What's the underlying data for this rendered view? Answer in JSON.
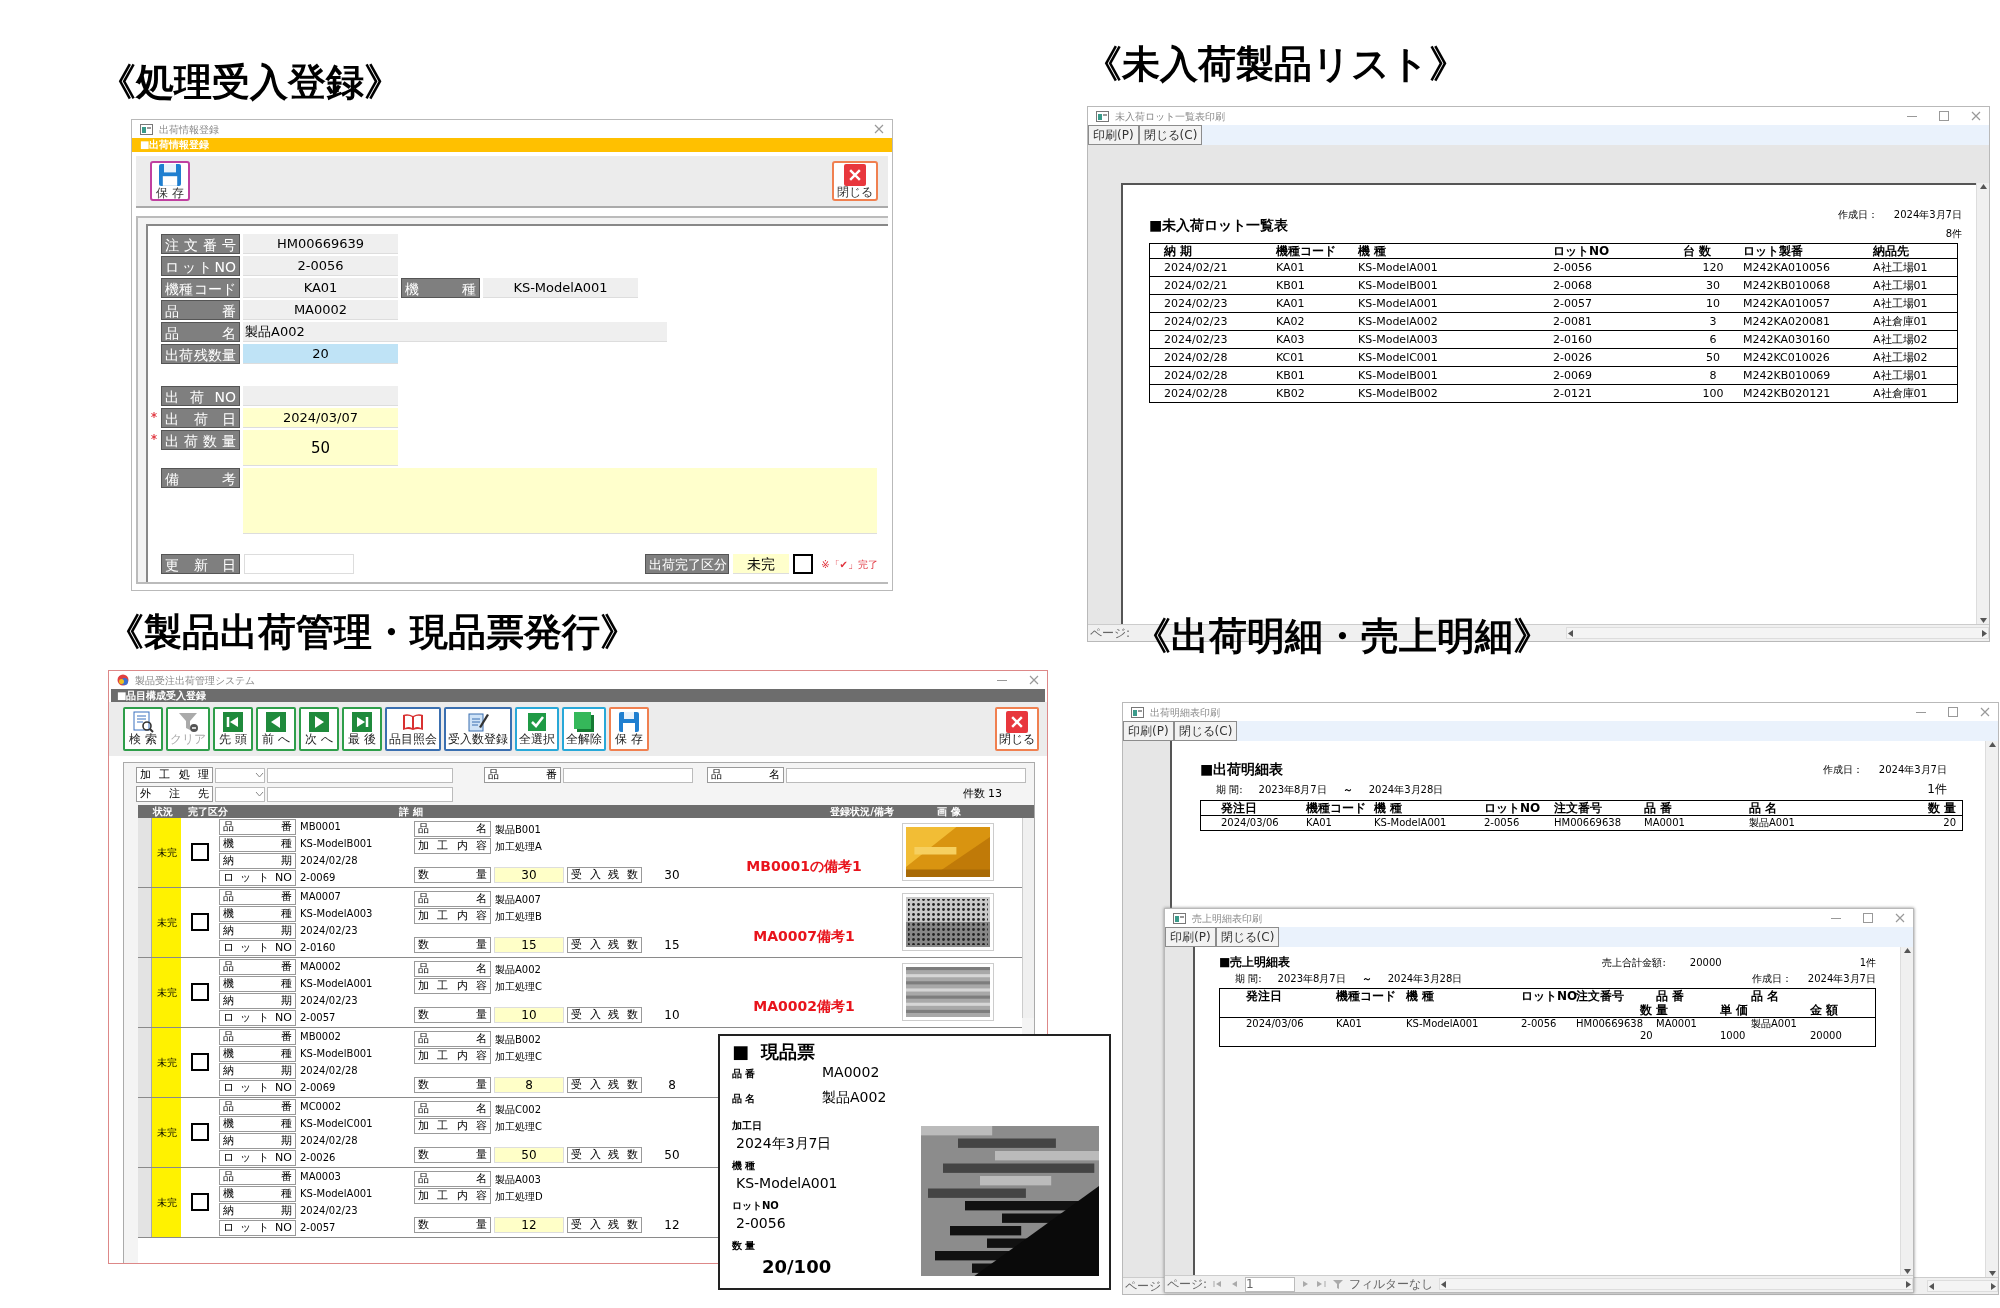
{
  "entry_form": {
    "heading": "《処理受入登録》",
    "window_title": "出荷情報登録",
    "banner": "■出荷情報登録",
    "save_button": "保 存",
    "close_button": "閉じる",
    "product_rows": [
      [
        {
          "label": "注文番号",
          "value": "HM00669639",
          "color": "#efefef",
          "kind": "short"
        }
      ],
      [
        {
          "label": "ロットNO",
          "value": "2-0056",
          "color": "#efefef",
          "kind": "short"
        }
      ],
      [
        {
          "label": "機種コード",
          "value": "KA01",
          "color": "#efefef",
          "kind": "short"
        },
        {
          "label": "機種",
          "value": "KS-ModelA001",
          "color": "#efefef",
          "kind": "short"
        }
      ],
      [
        {
          "label": "品番",
          "value": "MA0002",
          "color": "#efefef",
          "kind": "short"
        }
      ],
      [
        {
          "label": "品名",
          "value": "製品A002",
          "color": "#efefef",
          "kind": "wide"
        }
      ],
      [
        {
          "label": "出荷残数量",
          "value": "20",
          "color": "#bfe3f6",
          "kind": "short"
        }
      ]
    ],
    "shipment_fields": [
      {
        "label": "出荷NO",
        "color": "#efefef",
        "kind": "short",
        "required": false
      },
      {
        "label": "出荷日",
        "value": "2024/03/07",
        "color": "#ffffcc",
        "kind": "short",
        "required": true
      },
      {
        "label": "出荷数量",
        "value": "50",
        "color": "#ffffcc",
        "kind": "tall",
        "required": true
      },
      {
        "label": "備考",
        "color": "#ffffcc",
        "kind": "memo",
        "required": false
      }
    ],
    "update_label": "更新日",
    "completion": {
      "label": "出荷完了区分",
      "value": "未完",
      "checked": false,
      "note": "※「✔」完了"
    }
  },
  "unreceived_list": {
    "heading": "《未入荷製品リスト》",
    "window_title": "未入荷ロット一覧表印刷",
    "toolbar": [
      "印刷(P)",
      "閉じる(C)"
    ],
    "report_title": "■未入荷ロット一覧表",
    "created_label": "作成日：",
    "created_date": "2024年3月7日",
    "count": "8件",
    "columns": [
      "納 期",
      "機種コード",
      "機 種",
      "ロットNO",
      "台 数",
      "ロット製番",
      "納品先"
    ],
    "rows": [
      [
        "2024/02/21",
        "KA01",
        "KS-ModelA001",
        "2-0056",
        "120",
        "M242KA010056",
        "A社工場01"
      ],
      [
        "2024/02/21",
        "KB01",
        "KS-ModelB001",
        "2-0068",
        "30",
        "M242KB010068",
        "A社工場01"
      ],
      [
        "2024/02/23",
        "KA01",
        "KS-ModelA001",
        "2-0057",
        "10",
        "M242KA010057",
        "A社工場01"
      ],
      [
        "2024/02/23",
        "KA02",
        "KS-ModelA002",
        "2-0081",
        "3",
        "M242KA020081",
        "A社倉庫01"
      ],
      [
        "2024/02/23",
        "KA03",
        "KS-ModelA003",
        "2-0160",
        "6",
        "M242KA030160",
        "A社工場02"
      ],
      [
        "2024/02/28",
        "KC01",
        "KS-ModelC001",
        "2-0026",
        "50",
        "M242KC010026",
        "A社工場02"
      ],
      [
        "2024/02/28",
        "KB01",
        "KS-ModelB001",
        "2-0069",
        "8",
        "M242KB010069",
        "A社工場01"
      ],
      [
        "2024/02/28",
        "KB02",
        "KS-ModelB002",
        "2-0121",
        "100",
        "M242KB020121",
        "A社倉庫01"
      ]
    ],
    "status": "ページ:"
  },
  "shipping_system": {
    "heading": "《製品出荷管理・現品票発行》",
    "window_title": "製品受注出荷管理システム",
    "banner": "■品目構成受入登録",
    "toolbar": [
      {
        "label": "検 索",
        "disabled": false
      },
      {
        "label": "クリア",
        "disabled": true
      },
      {
        "label": "先 頭",
        "disabled": false
      },
      {
        "label": "前 へ",
        "disabled": false
      },
      {
        "label": "次 へ",
        "disabled": false
      },
      {
        "label": "最 後",
        "disabled": false
      },
      {
        "label": "品目照会",
        "disabled": false
      },
      {
        "label": "受入数登録",
        "disabled": false
      },
      {
        "label": "全選択",
        "disabled": false
      },
      {
        "label": "全解除",
        "disabled": false
      },
      {
        "label": "保 存",
        "disabled": false
      }
    ],
    "close_button": "閉じる",
    "filters": {
      "process_label": "加工処理",
      "part_no_label": "品番",
      "part_name_label": "品名",
      "vendor_label": "外注先",
      "count": "件数 13"
    },
    "columns": [
      "状況",
      "完了区分",
      "詳 細",
      "登録状況/備考",
      "画 像"
    ],
    "rows": [
      {
        "status": "未完",
        "checked": false,
        "details": [
          {
            "label": "品番",
            "value": "MB0001"
          },
          {
            "label": "機種",
            "value": "KS-ModelB001"
          },
          {
            "label": "納期",
            "value": "2024/02/28"
          },
          {
            "label": "ロットNO",
            "value": "2-0069"
          }
        ],
        "name": {
          "label": "品名",
          "value": "製品B001"
        },
        "process": {
          "label": "加工内容",
          "value": "加工処理A"
        },
        "quantity": {
          "label": "数量",
          "value": "30"
        },
        "remaining": {
          "label": "受入残数",
          "value": "30"
        },
        "remark": "MB0001の備考1",
        "image": {
          "kind": "picture"
        }
      },
      {
        "status": "未完",
        "checked": false,
        "details": [
          {
            "label": "品番",
            "value": "MA0007"
          },
          {
            "label": "機種",
            "value": "KS-ModelA003"
          },
          {
            "label": "納期",
            "value": "2024/02/23"
          },
          {
            "label": "ロットNO",
            "value": "2-0160"
          }
        ],
        "name": {
          "label": "品名",
          "value": "製品A007"
        },
        "process": {
          "label": "加工内容",
          "value": "加工処理B"
        },
        "quantity": {
          "label": "数量",
          "value": "15"
        },
        "remaining": {
          "label": "受入残数",
          "value": "15"
        },
        "remark": "MA0007備考1",
        "image": {
          "kind": "picture"
        }
      },
      {
        "status": "未完",
        "checked": false,
        "details": [
          {
            "label": "品番",
            "value": "MA0002"
          },
          {
            "label": "機種",
            "value": "KS-ModelA001"
          },
          {
            "label": "納期",
            "value": "2024/02/23"
          },
          {
            "label": "ロットNO",
            "value": "2-0057"
          }
        ],
        "name": {
          "label": "品名",
          "value": "製品A002"
        },
        "process": {
          "label": "加工内容",
          "value": "加工処理C"
        },
        "quantity": {
          "label": "数量",
          "value": "10"
        },
        "remaining": {
          "label": "受入残数",
          "value": "10"
        },
        "remark": "MA0002備考1",
        "image": {
          "kind": "picture"
        }
      },
      {
        "status": "未完",
        "checked": false,
        "details": [
          {
            "label": "品番",
            "value": "MB0002"
          },
          {
            "label": "機種",
            "value": "KS-ModelB001"
          },
          {
            "label": "納期",
            "value": "2024/02/28"
          },
          {
            "label": "ロットNO",
            "value": "2-0069"
          }
        ],
        "name": {
          "label": "品名",
          "value": "製品B002"
        },
        "process": {
          "label": "加工内容",
          "value": "加工処理C"
        },
        "quantity": {
          "label": "数量",
          "value": "8"
        },
        "remaining": {
          "label": "受入残数",
          "value": "8"
        }
      },
      {
        "status": "未完",
        "checked": false,
        "details": [
          {
            "label": "品番",
            "value": "MC0002"
          },
          {
            "label": "機種",
            "value": "KS-ModelC001"
          },
          {
            "label": "納期",
            "value": "2024/02/28"
          },
          {
            "label": "ロットNO",
            "value": "2-0026"
          }
        ],
        "name": {
          "label": "品名",
          "value": "製品C002"
        },
        "process": {
          "label": "加工内容",
          "value": "加工処理C"
        },
        "quantity": {
          "label": "数量",
          "value": "50"
        },
        "remaining": {
          "label": "受入残数",
          "value": "50"
        }
      },
      {
        "status": "未完",
        "checked": false,
        "details": [
          {
            "label": "品番",
            "value": "MA0003"
          },
          {
            "label": "機種",
            "value": "KS-ModelA001"
          },
          {
            "label": "納期",
            "value": "2024/02/23"
          },
          {
            "label": "ロットNO",
            "value": "2-0057"
          }
        ],
        "name": {
          "label": "品名",
          "value": "製品A003"
        },
        "process": {
          "label": "加工内容",
          "value": "加工処理D"
        },
        "quantity": {
          "label": "数量",
          "value": "12"
        },
        "remaining": {
          "label": "受入残数",
          "value": "12"
        }
      }
    ]
  },
  "item_tag": {
    "title_mark": "■",
    "title": "現品票",
    "fields": [
      {
        "label": "品 番",
        "value": "MA0002",
        "kind": "inline"
      },
      {
        "label": "品 名",
        "value": "製品A002",
        "kind": "inline"
      },
      {
        "label": "加工日",
        "value": "2024年3月7日",
        "kind": "stacked"
      },
      {
        "label": "機 種",
        "value": "KS-ModelA001",
        "kind": "stacked"
      },
      {
        "label": "ロットNO",
        "value": "2-0056",
        "kind": "stacked"
      },
      {
        "label": "数 量",
        "value": "20/100",
        "kind": "emphasis"
      }
    ],
    "image": {
      "kind": "picture"
    }
  },
  "shipping_detail": {
    "heading": "《出荷明細・売上明細》",
    "window_title": "出荷明細表印刷",
    "toolbar": [
      "印刷(P)",
      "閉じる(C)"
    ],
    "report_title": "■出荷明細表",
    "period_label": "期 間:",
    "period_from": "2023年8月7日",
    "period_sep": "～",
    "period_to": "2024年3月28日",
    "created_label": "作成日：",
    "created_date": "2024年3月7日",
    "count": "1件",
    "columns": [
      "発注日",
      "機種コード",
      "機 種",
      "ロットNO",
      "注文番号",
      "品 番",
      "品 名",
      "数 量"
    ],
    "rows": [
      [
        "2024/03/06",
        "KA01",
        "KS-ModelA001",
        "2-0056",
        "HM00669638",
        "MA0001",
        "製品A001",
        "20"
      ]
    ],
    "status": "ページ"
  },
  "sales_detail": {
    "window_title": "売上明細表印刷",
    "toolbar": [
      "印刷(P)",
      "閉じる(C)"
    ],
    "report_title": "■売上明細表",
    "period_label": "期 間:",
    "period_from": "2023年8月7日",
    "period_sep": "～",
    "period_to": "2024年3月28日",
    "total_label": "売上合計金額:",
    "total": "20000",
    "count": "1件",
    "created_label": "作成日：",
    "created_date": "2024年3月7日",
    "columns": [
      "発注日",
      "機種コード",
      "機 種",
      "ロットNO",
      "注文番号",
      "品 番",
      "品 名"
    ],
    "sub_columns": [
      "数 量",
      "単 価",
      "金 額"
    ],
    "rows": [
      {
        "cells": [
          "2024/03/06",
          "KA01",
          "KS-ModelA001",
          "2-0056",
          "HM00669638",
          "MA0001",
          "製品A001"
        ],
        "sub_cells": [
          "20",
          "1000",
          "20000"
        ]
      }
    ],
    "status": {
      "page_label": "ページ:",
      "page": "1",
      "filter": "フィルターなし"
    }
  }
}
